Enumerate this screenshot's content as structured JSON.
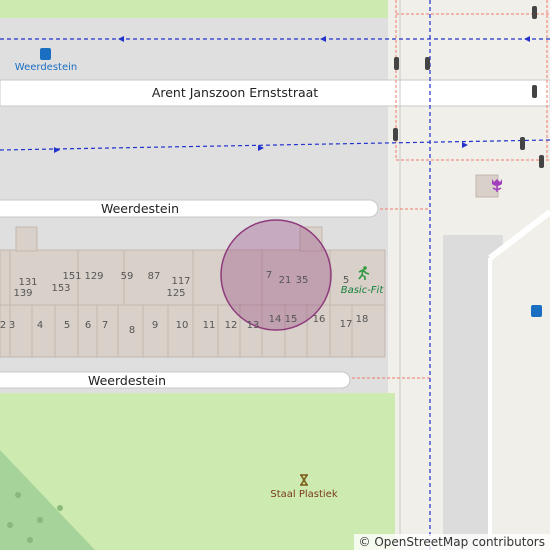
{
  "map": {
    "roads": [
      {
        "id": "road-arent",
        "label": "Arent Janszoon Ernststraat"
      },
      {
        "id": "road-weerdestein-north",
        "label": "Weerdestein"
      },
      {
        "id": "road-weerdestein-south",
        "label": "Weerdestein"
      }
    ],
    "bus_stop": {
      "label": "Weerdestein",
      "icon": "bus-stop-icon"
    },
    "poi": {
      "label": "Basic-Fit",
      "icon": "fitness-centre-icon",
      "color": "#2e9a3e"
    },
    "artwork": {
      "label": "Staal Plastiek",
      "icon": "artwork-icon"
    },
    "house_numbers": [
      "131",
      "139",
      "151",
      "153",
      "129",
      "59",
      "87",
      "117",
      "125",
      "7",
      "21",
      "35",
      "5",
      "2",
      "3",
      "4",
      "5",
      "6",
      "7",
      "8",
      "9",
      "10",
      "11",
      "12",
      "13",
      "14",
      "15",
      "16",
      "17",
      "18"
    ],
    "highlight_color": "#8e3b7d",
    "attribution": "© OpenStreetMap contributors"
  }
}
